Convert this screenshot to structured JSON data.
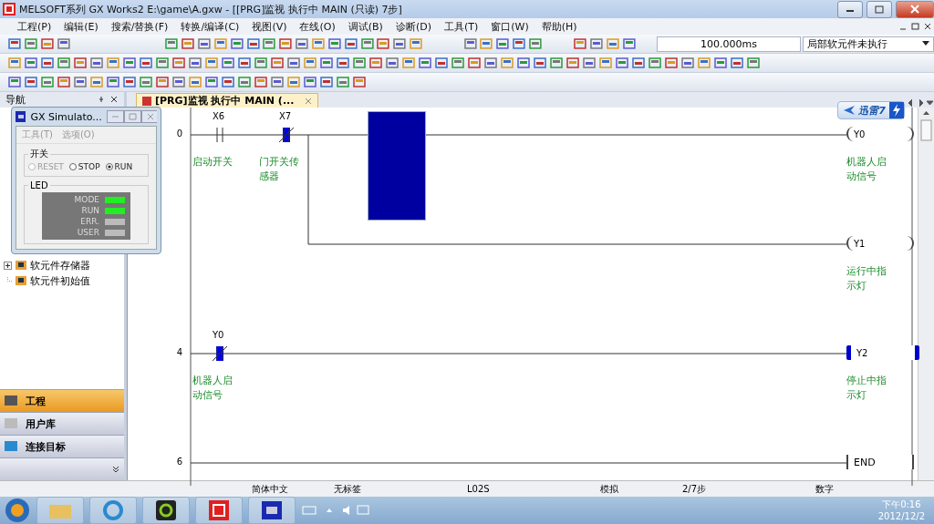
{
  "window": {
    "title": "MELSOFT系列 GX Works2 E:\\game\\A.gxw - [[PRG]监视 执行中 MAIN (只读) 7步]"
  },
  "menu": [
    "工程(P)",
    "编辑(E)",
    "搜索/替换(F)",
    "转换/编译(C)",
    "视图(V)",
    "在线(O)",
    "调试(B)",
    "诊断(D)",
    "工具(T)",
    "窗口(W)",
    "帮助(H)"
  ],
  "toolbar": {
    "scan_time": "100.000ms",
    "monitor_mode": "局部软元件未执行"
  },
  "navigation": {
    "title": "导航",
    "tree": [
      {
        "label": "软元件存储器",
        "has_children": true
      },
      {
        "label": "软元件初始值",
        "has_children": false
      }
    ],
    "sections": [
      {
        "label": "工程",
        "selected": true
      },
      {
        "label": "用户库",
        "selected": false
      },
      {
        "label": "连接目标",
        "selected": false
      }
    ]
  },
  "editor_tab": {
    "label": "[PRG]监视 执行中 MAIN (..."
  },
  "simulator": {
    "title": "GX Simulato...",
    "menu": [
      "工具(T)",
      "选项(O)"
    ],
    "switch": {
      "title": "开关",
      "options": [
        {
          "label": "RESET",
          "selected": false,
          "disabled": true
        },
        {
          "label": "STOP",
          "selected": false,
          "disabled": false
        },
        {
          "label": "RUN",
          "selected": true,
          "disabled": false
        }
      ]
    },
    "led": {
      "title": "LED",
      "lamps": [
        {
          "label": "MODE",
          "on": true
        },
        {
          "label": "RUN",
          "on": true
        },
        {
          "label": "ERR.",
          "on": false
        },
        {
          "label": "USER",
          "on": false
        }
      ]
    }
  },
  "ladder": {
    "rungs": [
      {
        "step": "0",
        "contacts": [
          {
            "device": "X6",
            "comment": "启动开关",
            "kind": "no",
            "on": false
          },
          {
            "device": "X7",
            "comment": "门开关传感器",
            "kind": "nc",
            "on": true
          }
        ],
        "coils": [
          {
            "device": "Y0",
            "comment": "机器人启动信号",
            "kind": "coil",
            "on": false
          },
          {
            "device": "Y1",
            "comment": "运行中指示灯",
            "kind": "coil",
            "on": false
          }
        ]
      },
      {
        "step": "4",
        "contacts": [
          {
            "device": "Y0",
            "comment": "机器人启动信号",
            "kind": "nc",
            "on": true
          }
        ],
        "coils": [
          {
            "device": "Y2",
            "comment": "停止中指示灯",
            "kind": "coil",
            "on": true
          }
        ]
      },
      {
        "step": "6",
        "coils": [
          {
            "device": "END",
            "kind": "end"
          }
        ]
      }
    ]
  },
  "overlay_badge": {
    "label": "迅雷7"
  },
  "status_bar": [
    "简体中文",
    "无标签",
    "L02S",
    "模拟",
    "2/7步",
    "数字"
  ],
  "taskbar": {
    "time": "下午0:16",
    "date": "2012/12/2"
  }
}
